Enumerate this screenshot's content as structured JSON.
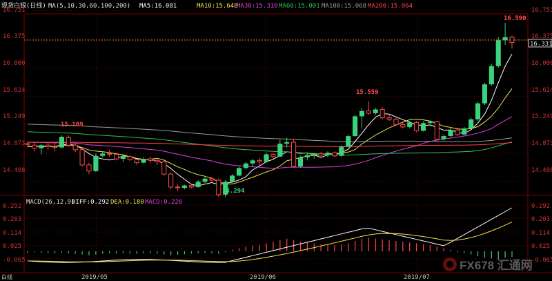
{
  "header": {
    "instrument": "现货白银(日线)",
    "ma_params": "MA(5,10,30,60,100,200)",
    "ma_values": [
      {
        "label": "MA5:16.081",
        "color": "#ffffff"
      },
      {
        "label": "MA10:15.648",
        "color": "#f0e64b"
      },
      {
        "label": "MA30:15.310",
        "color": "#e040e0"
      },
      {
        "label": "MA60:15.001",
        "color": "#36c24b"
      },
      {
        "label": "MA100:15.068",
        "color": "#9a9a9a"
      },
      {
        "label": "MA200:15.064",
        "color": "#ff4040"
      }
    ]
  },
  "price_axis": {
    "ticks": [
      "16.751",
      "16.375",
      "16.000",
      "15.624",
      "15.249",
      "14.873",
      "14.498"
    ],
    "current_price": "16.331"
  },
  "annotations": {
    "high": "16.590",
    "mid_peak": "15.559",
    "left_peak": "15.109",
    "low": "14.294"
  },
  "macd": {
    "header": "MACD(26,12,9)",
    "diff": "DIFF:0.292",
    "dea": "DEA:0.180",
    "macd": "MACD:0.226",
    "ticks": [
      "0.292",
      "0.203",
      "0.114",
      "0.025",
      "-0.065"
    ]
  },
  "dates": [
    "2019/05",
    "2019/06",
    "2019/07"
  ],
  "watermark": "FX678 汇通网",
  "side_label": "白线",
  "colors": {
    "up": "#3ad27a",
    "down": "#ff4a4a",
    "grid": "#7a0000",
    "axis_text": "#d03030",
    "title": "#e0e0e0",
    "price_line": "#d08040"
  },
  "chart_data": {
    "type": "candlestick",
    "y_range": [
      14.32,
      16.78
    ],
    "candles": [
      [
        15.0,
        15.03,
        14.95,
        14.99
      ],
      [
        14.98,
        15.02,
        14.9,
        14.94
      ],
      [
        14.94,
        15.0,
        14.86,
        14.98
      ],
      [
        14.98,
        15.02,
        14.92,
        14.96
      ],
      [
        14.96,
        15.01,
        14.9,
        14.95
      ],
      [
        14.95,
        15.109,
        14.94,
        15.09
      ],
      [
        15.08,
        15.11,
        14.96,
        14.98
      ],
      [
        14.98,
        15.0,
        14.89,
        14.92
      ],
      [
        14.92,
        14.94,
        14.7,
        14.72
      ],
      [
        14.72,
        14.75,
        14.6,
        14.64
      ],
      [
        14.64,
        14.87,
        14.63,
        14.84
      ],
      [
        14.84,
        14.9,
        14.82,
        14.87
      ],
      [
        14.87,
        14.92,
        14.83,
        14.86
      ],
      [
        14.86,
        14.88,
        14.78,
        14.8
      ],
      [
        14.8,
        14.86,
        14.76,
        14.83
      ],
      [
        14.83,
        14.85,
        14.77,
        14.79
      ],
      [
        14.79,
        14.8,
        14.72,
        14.75
      ],
      [
        14.75,
        14.82,
        14.74,
        14.8
      ],
      [
        14.8,
        14.83,
        14.75,
        14.78
      ],
      [
        14.78,
        14.8,
        14.72,
        14.76
      ],
      [
        14.76,
        14.78,
        14.58,
        14.6
      ],
      [
        14.6,
        14.62,
        14.4,
        14.43
      ],
      [
        14.43,
        14.46,
        14.38,
        14.42
      ],
      [
        14.42,
        14.46,
        14.4,
        14.45
      ],
      [
        14.45,
        14.47,
        14.41,
        14.43
      ],
      [
        14.43,
        14.52,
        14.42,
        14.5
      ],
      [
        14.5,
        14.56,
        14.48,
        14.54
      ],
      [
        14.54,
        14.56,
        14.5,
        14.52
      ],
      [
        14.52,
        14.54,
        14.3,
        14.33
      ],
      [
        14.33,
        14.52,
        14.294,
        14.5
      ],
      [
        14.5,
        14.6,
        14.49,
        14.58
      ],
      [
        14.58,
        14.7,
        14.57,
        14.68
      ],
      [
        14.68,
        14.76,
        14.66,
        14.74
      ],
      [
        14.74,
        14.8,
        14.7,
        14.78
      ],
      [
        14.78,
        14.81,
        14.72,
        14.76
      ],
      [
        14.76,
        14.88,
        14.75,
        14.86
      ],
      [
        14.86,
        14.88,
        14.8,
        14.83
      ],
      [
        14.83,
        15.05,
        14.82,
        15.0
      ],
      [
        15.0,
        15.08,
        14.95,
        15.02
      ],
      [
        15.02,
        15.05,
        14.68,
        14.7
      ],
      [
        14.7,
        14.84,
        14.68,
        14.82
      ],
      [
        14.82,
        14.88,
        14.78,
        14.85
      ],
      [
        14.85,
        14.88,
        14.8,
        14.87
      ],
      [
        14.87,
        14.89,
        14.83,
        14.85
      ],
      [
        14.85,
        14.9,
        14.82,
        14.88
      ],
      [
        14.88,
        14.9,
        14.82,
        14.84
      ],
      [
        14.84,
        14.98,
        14.83,
        14.96
      ],
      [
        14.96,
        15.12,
        14.95,
        15.1
      ],
      [
        15.1,
        15.38,
        15.09,
        15.36
      ],
      [
        15.36,
        15.47,
        15.2,
        15.43
      ],
      [
        15.43,
        15.559,
        15.38,
        15.4
      ],
      [
        15.4,
        15.47,
        15.38,
        15.45
      ],
      [
        15.45,
        15.48,
        15.32,
        15.34
      ],
      [
        15.34,
        15.38,
        15.3,
        15.32
      ],
      [
        15.32,
        15.36,
        15.23,
        15.25
      ],
      [
        15.25,
        15.29,
        15.2,
        15.22
      ],
      [
        15.22,
        15.3,
        15.2,
        15.28
      ],
      [
        15.28,
        15.3,
        15.15,
        15.17
      ],
      [
        15.17,
        15.29,
        15.16,
        15.27
      ],
      [
        15.27,
        15.3,
        15.23,
        15.29
      ],
      [
        15.29,
        15.3,
        15.05,
        15.06
      ],
      [
        15.06,
        15.12,
        15.04,
        15.1
      ],
      [
        15.1,
        15.22,
        15.09,
        15.18
      ],
      [
        15.18,
        15.21,
        15.1,
        15.12
      ],
      [
        15.12,
        15.22,
        15.11,
        15.2
      ],
      [
        15.2,
        15.34,
        15.19,
        15.32
      ],
      [
        15.32,
        15.55,
        15.3,
        15.53
      ],
      [
        15.53,
        15.8,
        15.51,
        15.78
      ],
      [
        15.78,
        16.05,
        15.76,
        16.02
      ],
      [
        16.02,
        16.4,
        16.0,
        16.36
      ],
      [
        16.36,
        16.59,
        16.3,
        16.4
      ],
      [
        16.4,
        16.42,
        16.25,
        16.331
      ]
    ],
    "macd_hist": [
      -0.01,
      -0.005,
      -0.008,
      -0.01,
      -0.012,
      -0.008,
      -0.012,
      -0.015,
      -0.02,
      -0.025,
      -0.02,
      -0.015,
      -0.012,
      -0.014,
      -0.012,
      -0.014,
      -0.016,
      -0.012,
      -0.012,
      -0.014,
      -0.02,
      -0.025,
      -0.022,
      -0.018,
      -0.015,
      -0.012,
      -0.01,
      -0.012,
      -0.015,
      -0.005,
      0.01,
      0.02,
      0.03,
      0.035,
      0.04,
      0.05,
      0.06,
      0.07,
      0.08,
      0.07,
      0.06,
      0.055,
      0.05,
      0.045,
      0.04,
      0.038,
      0.04,
      0.05,
      0.065,
      0.08,
      0.085,
      0.08,
      0.075,
      0.07,
      0.065,
      0.06,
      0.055,
      0.05,
      0.045,
      0.04,
      0.03,
      0.02,
      0.01,
      -0.005,
      -0.01,
      -0.02,
      -0.03,
      -0.04,
      -0.045,
      -0.05,
      -0.04,
      -0.035
    ],
    "diff_start": -0.06,
    "diff_end": 0.292,
    "dea_end": 0.18
  }
}
